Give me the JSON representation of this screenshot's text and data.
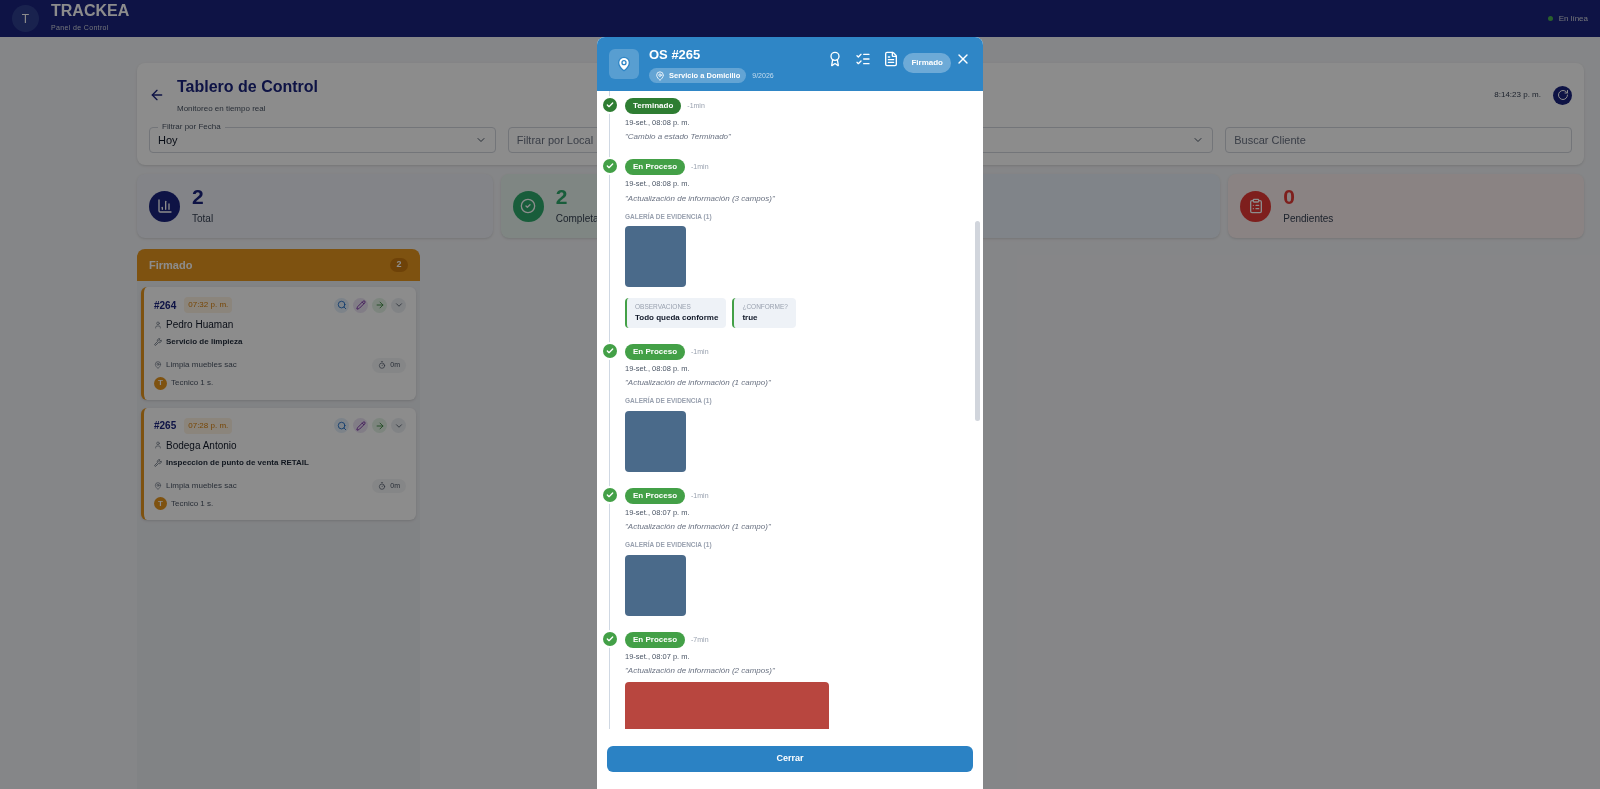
{
  "header": {
    "logo_letter": "T",
    "title": "TRACKEA",
    "subtitle": "Panel de Control",
    "status": {
      "label": "En línea",
      "online": true
    }
  },
  "dashboard": {
    "title": "Tablero de Control",
    "subtitle": "Monitoreo en tiempo real",
    "clock": "8:14:23 p. m.",
    "filters": [
      {
        "kind": "select",
        "label": "Filtrar por Fecha",
        "value": "Hoy"
      },
      {
        "kind": "select",
        "placeholder": "Filtrar por Local"
      },
      {
        "kind": "select"
      },
      {
        "kind": "text",
        "placeholder": "Buscar Cliente"
      }
    ]
  },
  "stats": [
    {
      "kind": "total",
      "value": "2",
      "label": "Total"
    },
    {
      "kind": "done",
      "value": "2",
      "label": "Completa"
    },
    {
      "kind": "progress"
    },
    {
      "kind": "pending",
      "value": "0",
      "label": "Pendientes"
    }
  ],
  "column": {
    "title": "Firmado",
    "count": "2",
    "cards": [
      {
        "number": "#264",
        "time": "07:32 p. m.",
        "client": "Pedro Huaman",
        "service": "Servicio de limpieza",
        "location": "Limpia muebles sac",
        "timer": "0m",
        "tech_initial": "T",
        "tech": "Tecnico 1 s."
      },
      {
        "number": "#265",
        "time": "07:28 p. m.",
        "client": "Bodega Antonio",
        "service": "Inspeccion de punto de venta RETAIL",
        "location": "Limpia muebles sac",
        "timer": "0m",
        "tech_initial": "T",
        "tech": "Tecnico 1 s."
      }
    ]
  },
  "modal": {
    "title": "OS #265",
    "type": "Servicio a Domicilio",
    "date": "9/2026",
    "status": "Firmado",
    "events": [
      {
        "kind": "done",
        "status": "Terminado",
        "ago": "-1min",
        "time": "19-set., 08:08 p. m.",
        "note": "\"Cambio a estado Terminado\""
      },
      {
        "kind": "progress",
        "status": "En Proceso",
        "ago": "-1min",
        "time": "19-set., 08:08 p. m.",
        "note": "\"Actualización de información (3 campos)\"",
        "gallery": "GALERÍA DE EVIDENCIA (1)",
        "photo": {
          "kind": "small"
        },
        "fields": [
          {
            "label": "OBSERVACIONES",
            "value": "Todo queda conforme"
          },
          {
            "label": "¿CONFORME?",
            "value": "true"
          }
        ]
      },
      {
        "kind": "progress",
        "status": "En Proceso",
        "ago": "-1min",
        "time": "19-set., 08:08 p. m.",
        "note": "\"Actualización de información (1 campo)\"",
        "gallery": "GALERÍA DE EVIDENCIA (1)",
        "photo": {
          "kind": "small"
        }
      },
      {
        "kind": "progress",
        "status": "En Proceso",
        "ago": "-1min",
        "time": "19-set., 08:07 p. m.",
        "note": "\"Actualización de información (1 campo)\"",
        "gallery": "GALERÍA DE EVIDENCIA (1)",
        "photo": {
          "kind": "small"
        }
      },
      {
        "kind": "progress",
        "status": "En Proceso",
        "ago": "-7min",
        "time": "19-set., 08:07 p. m.",
        "note": "\"Actualización de información (2 campos)\"",
        "photo": {
          "kind": "large"
        }
      }
    ],
    "close_label": "Cerrar"
  }
}
